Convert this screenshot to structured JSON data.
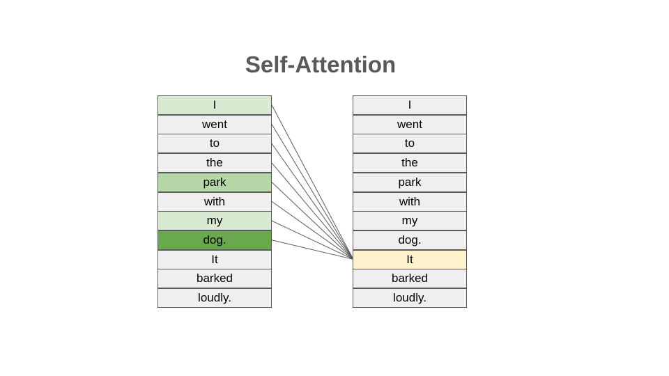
{
  "title": "Self-Attention",
  "left_tokens": [
    {
      "text": "I",
      "color": "#d9ead3"
    },
    {
      "text": "went",
      "color": "#efefef"
    },
    {
      "text": "to",
      "color": "#efefef"
    },
    {
      "text": "the",
      "color": "#efefef"
    },
    {
      "text": "park",
      "color": "#b6d7a8"
    },
    {
      "text": "with",
      "color": "#efefef"
    },
    {
      "text": "my",
      "color": "#d9ead3"
    },
    {
      "text": "dog.",
      "color": "#6aa84f"
    },
    {
      "text": "It",
      "color": "#efefef"
    },
    {
      "text": "barked",
      "color": "#efefef"
    },
    {
      "text": "loudly.",
      "color": "#efefef"
    }
  ],
  "right_tokens": [
    {
      "text": "I",
      "color": "#efefef"
    },
    {
      "text": "went",
      "color": "#efefef"
    },
    {
      "text": "to",
      "color": "#efefef"
    },
    {
      "text": "the",
      "color": "#efefef"
    },
    {
      "text": "park",
      "color": "#efefef"
    },
    {
      "text": "with",
      "color": "#efefef"
    },
    {
      "text": "my",
      "color": "#efefef"
    },
    {
      "text": "dog.",
      "color": "#efefef"
    },
    {
      "text": "It",
      "color": "#fff2cc"
    },
    {
      "text": "barked",
      "color": "#efefef"
    },
    {
      "text": "loudly.",
      "color": "#efefef"
    }
  ],
  "connections": {
    "target": "It",
    "sources": [
      "I",
      "went",
      "to",
      "the",
      "park",
      "with",
      "my",
      "dog."
    ]
  }
}
